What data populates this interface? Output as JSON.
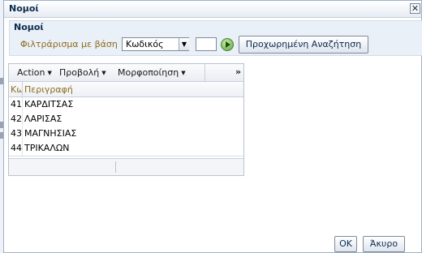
{
  "dialog": {
    "title": "Νομοί",
    "close_glyph": "✕"
  },
  "panel": {
    "header": "Νομοί"
  },
  "filter": {
    "label": "Φιλτράρισμα με βάση",
    "selected": "Κωδικός",
    "input_value": "",
    "advanced_label": "Προχωρημένη Αναζήτηση"
  },
  "toolbar": {
    "menus": [
      "Action",
      "Προβολή",
      "Μορφοποίηση"
    ],
    "overflow": "»"
  },
  "table": {
    "headers": {
      "code": "Κωδ",
      "description": "Περιγραφή"
    },
    "rows": [
      {
        "code": "41",
        "description": "ΚΑΡΔΙΤΣΑΣ"
      },
      {
        "code": "42",
        "description": "ΛΑΡΙΣΑΣ"
      },
      {
        "code": "43",
        "description": "ΜΑΓΝΗΣΙΑΣ"
      },
      {
        "code": "44",
        "description": "ΤΡΙΚΑΛΩΝ"
      }
    ]
  },
  "buttons": {
    "ok": "OK",
    "cancel": "Άκυρο"
  },
  "icons": {
    "close": "close-icon",
    "go": "go-arrow-icon",
    "dropdown": "chevron-down-icon",
    "overflow": "double-chevron-right-icon"
  }
}
